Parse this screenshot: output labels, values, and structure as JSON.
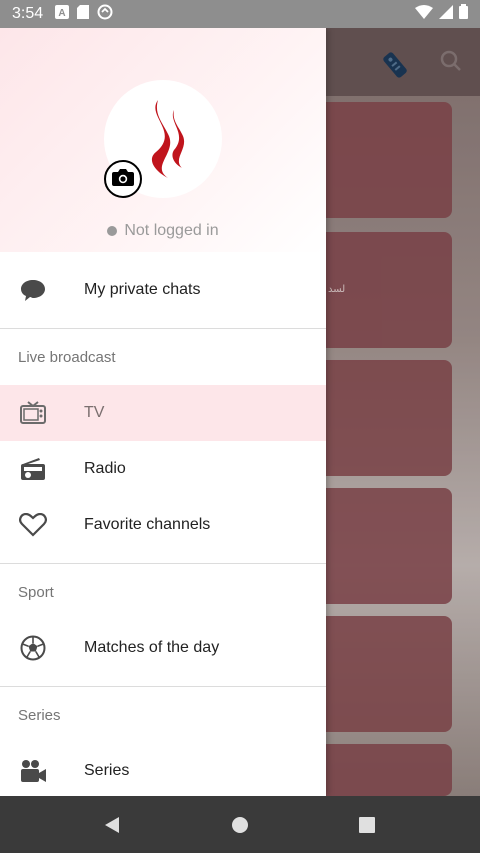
{
  "status_bar": {
    "time": "3:54"
  },
  "background_app": {
    "card_snippet": "لسد"
  },
  "drawer": {
    "login_status": "Not logged in",
    "items": {
      "private_chats": "My private chats",
      "tv": "TV",
      "radio": "Radio",
      "favorites": "Favorite channels",
      "matches": "Matches of the day",
      "series": "Series"
    },
    "sections": {
      "live": "Live broadcast",
      "sport": "Sport",
      "series": "Series"
    }
  },
  "colors": {
    "accent": "#fde6e9",
    "logo_red": "#c0141c",
    "toolbar": "#6e5a5a"
  }
}
